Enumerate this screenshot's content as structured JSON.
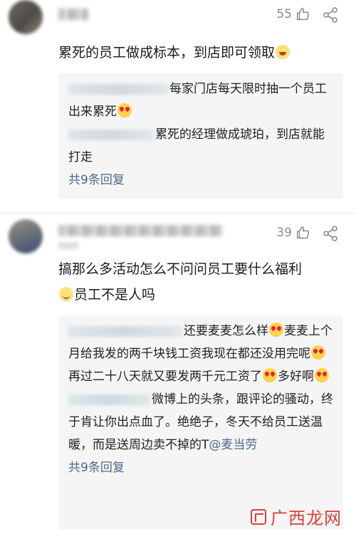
{
  "comments": [
    {
      "likes": "55",
      "text": "累死的员工做成标本，到店即可领取",
      "replies": [
        {
          "text": "每家门店每天限时抽一个员工出来累死"
        },
        {
          "text": "累死的经理做成琥珀，到店就能打走"
        }
      ],
      "more_replies": "共9条回复"
    },
    {
      "likes": "39",
      "text_line1": "搞那么多活动怎么不问问员工要什么福利",
      "text_line2": "员工不是人吗",
      "replies": [
        {
          "text_a": "还要麦麦怎么样",
          "text_b": "麦麦上个月给我发的两千块钱工资我现在都还没用完呢",
          "text_c": "再过二十八天就又要发两千元工资了",
          "text_d": "多好啊"
        },
        {
          "text": "微博上的头条，跟评论的骚动，终于肯让你出点血了。绝绝子，冬天不给员工送温暖，而是送周边卖不掉的T",
          "mention": "@麦当劳"
        }
      ],
      "more_replies": "共9条回复"
    }
  ],
  "icons": {
    "like": "thumbs-up-icon",
    "share": "share-icon",
    "emoji_heart_eyes": "heart-eyes-emoji",
    "emoji_laugh": "laughing-emoji",
    "emoji_smile": "smile-emoji"
  },
  "colors": {
    "link": "#4e6a8f",
    "reply_bg": "#f5f5f5",
    "watermark": "#d7413a"
  },
  "watermark": {
    "text": "广西龙网"
  }
}
